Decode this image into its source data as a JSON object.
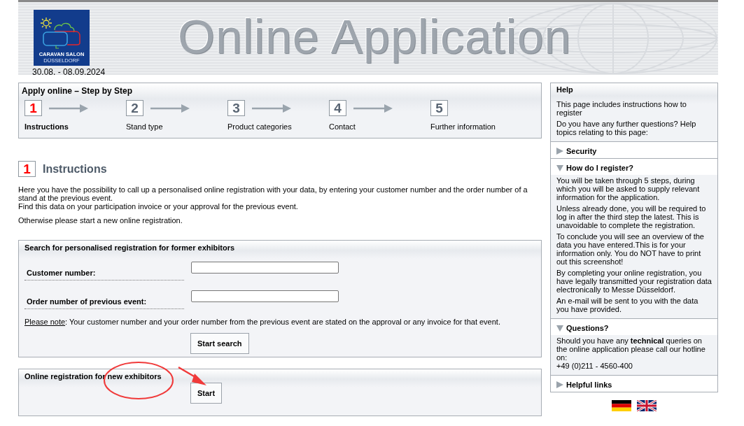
{
  "header": {
    "logo": {
      "line1": "CARAVAN SALON",
      "line2": "DÜSSELDORF"
    },
    "dates": "30.08. - 08.09.2024",
    "title": "Online Application"
  },
  "steps": {
    "title": "Apply online – Step by Step",
    "items": [
      {
        "number": "1",
        "label": "Instructions",
        "selected": true
      },
      {
        "number": "2",
        "label": "Stand type",
        "selected": false
      },
      {
        "number": "3",
        "label": "Product categories",
        "selected": false
      },
      {
        "number": "4",
        "label": "Contact",
        "selected": false
      },
      {
        "number": "5",
        "label": "Further information",
        "selected": false
      }
    ]
  },
  "instructions": {
    "number": "1",
    "heading": "Instructions",
    "paragraphs": [
      "Here you have the possibility to call up a personalised online registration with your data, by entering your customer number and the order number of a stand at the previous event.",
      "Find this data on your participation invoice or your approval for the previous event.",
      "Otherwise please start a new online registration."
    ]
  },
  "search_panel": {
    "title": "Search for personalised registration for former exhibitors",
    "fields": [
      {
        "label": "Customer number:"
      },
      {
        "label": "Order number of previous event:"
      }
    ],
    "note_label": "Please note",
    "note_text": ": Your customer number and your order number from the previous event are stated on the approval or any invoice for that event.",
    "button": "Start search"
  },
  "new_panel": {
    "title": "Online registration for new exhibitors",
    "button": "Start"
  },
  "help": {
    "title": "Help",
    "intro": [
      "This page includes instructions how to register",
      "Do you have any further questions? Help topics relating to this page:"
    ],
    "topics": [
      {
        "title": "Security",
        "expanded": false
      },
      {
        "title": "How do I register?",
        "expanded": true,
        "paragraphs": [
          "You will be taken through 5 steps, during which you will be asked to supply relevant information for the application.",
          "Unless already done, you will be required to log in after the third step the latest. This is unavoidable to complete the registration.",
          "To conclude you will see an overview of the data you have entered.This is for your information only. You do NOT have to print out this screenshot!",
          "By completing your online registration, you have legally transmitted your registration data electronically to Messe Düsseldorf.",
          "An e-mail will be sent to you with the data you have provided."
        ]
      },
      {
        "title": "Questions?",
        "expanded": true,
        "paragraphs": [
          "Should you have any **technical** queries on the online application please call our hotline on:\n+49 (0)211 - 4560-400"
        ]
      },
      {
        "title": "Helpful links",
        "expanded": false
      }
    ]
  },
  "languages": [
    {
      "kind": "german"
    },
    {
      "kind": "english"
    }
  ]
}
